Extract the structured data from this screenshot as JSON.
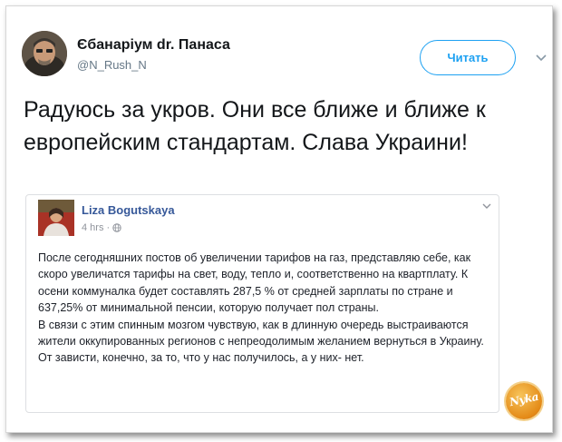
{
  "tweet": {
    "display_name": "Єбанаріум dr. Панаса",
    "handle": "@N_Rush_N",
    "follow_label": "Читать",
    "text": "Радуюсь за укров. Они все ближе и ближе к европейским стандартам. Слава Украини!",
    "icons": {
      "avatar": "user-avatar-photo",
      "menu": "chevron-down-icon"
    }
  },
  "embedded_post": {
    "author": "Liza Bogutskaya",
    "time": "4 hrs",
    "separator": "·",
    "icons": {
      "privacy": "globe-icon",
      "menu": "chevron-down-icon"
    },
    "paragraphs": [
      "После сегодняшних постов об увеличении тарифов на газ, представляю себе, как скоро увеличатся тарифы на свет, воду, тепло и, соответственно на квартплату. К осени коммуналка будет составлять 287,5 % от средней зарплаты по стране и 637,25% от минимальной пенсии, которую получает пол страны.",
      "В связи с этим спинным мозгом чувствую, как в длинную очередь выстраиваются жители оккупированных регионов с непреодолимым желанием вернуться в Украину. От зависти, конечно, за то, что у нас получилось, а у них- нет."
    ]
  },
  "watermark": {
    "text": "Nyka"
  },
  "colors": {
    "follow_blue": "#1da1f2",
    "fb_name_blue": "#365899",
    "text_dark": "#14171a",
    "muted": "#657786"
  }
}
